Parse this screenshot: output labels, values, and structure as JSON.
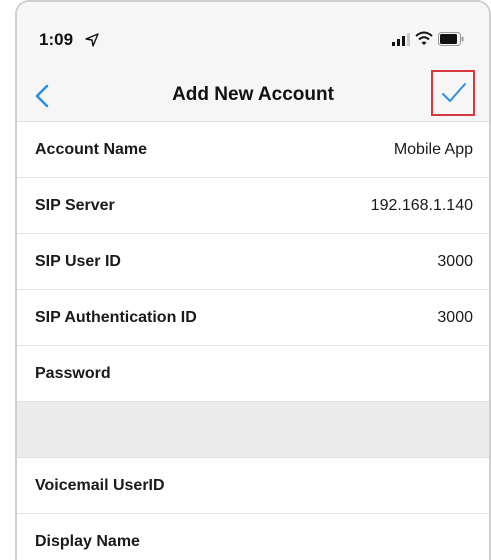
{
  "status_bar": {
    "time": "1:09",
    "icons": [
      "location-arrow-icon",
      "signal-bars-icon",
      "wifi-icon",
      "battery-icon"
    ]
  },
  "nav": {
    "title": "Add New Account",
    "back_icon": "chevron-left-icon",
    "done_icon": "checkmark-icon"
  },
  "colors": {
    "accent": "#2f8fe0",
    "highlight_border": "#d9383f",
    "bar_background": "#f6f6f6",
    "section_gap": "#ececec"
  },
  "fields": [
    {
      "label": "Account Name",
      "value": "Mobile App"
    },
    {
      "label": "SIP Server",
      "value": "192.168.1.140"
    },
    {
      "label": "SIP User ID",
      "value": "3000"
    },
    {
      "label": "SIP Authentication ID",
      "value": "3000"
    },
    {
      "label": "Password",
      "value": ""
    },
    {
      "label": "Voicemail UserID",
      "value": ""
    },
    {
      "label": "Display Name",
      "value": ""
    }
  ]
}
